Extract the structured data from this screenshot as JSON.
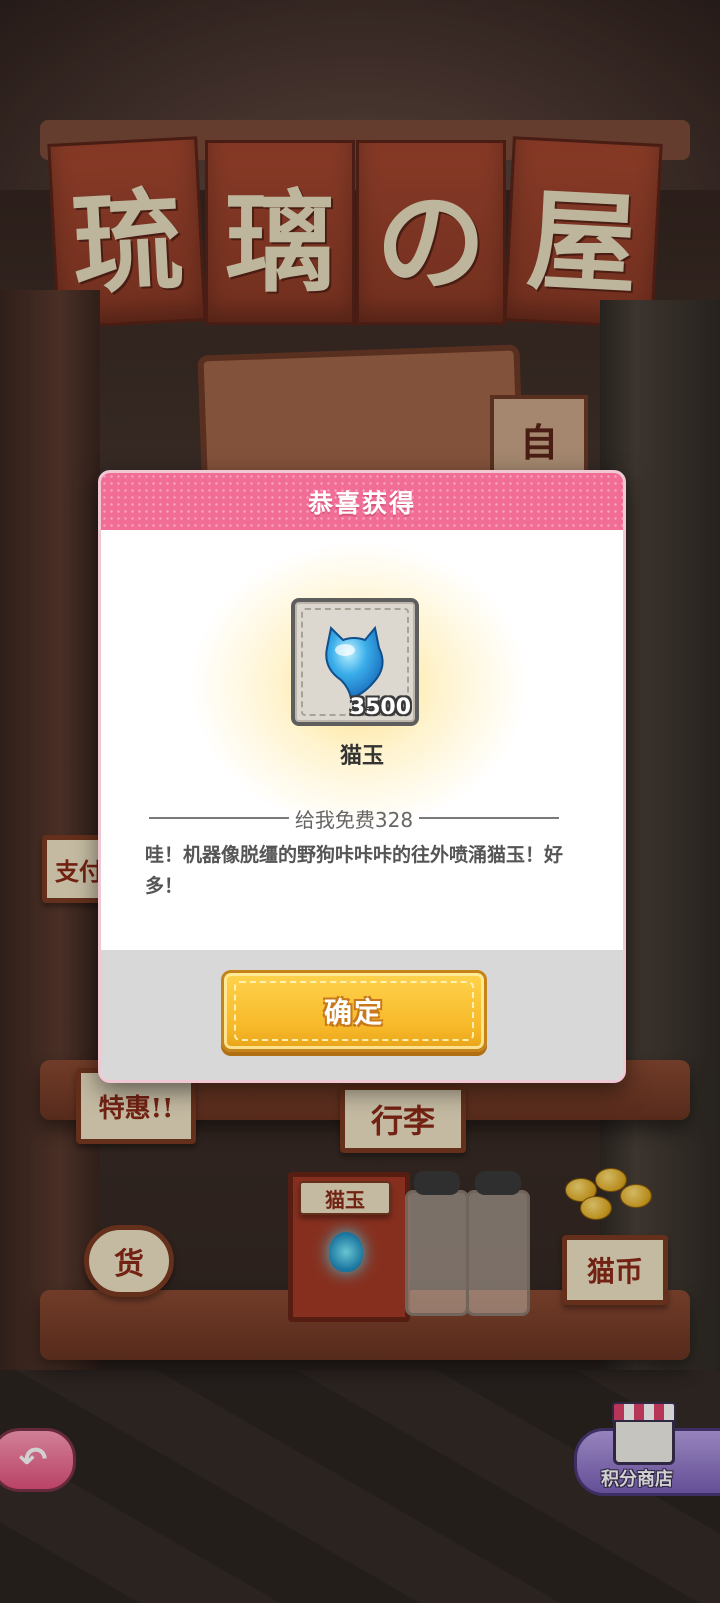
{
  "shop": {
    "banner_chars": [
      "琉",
      "璃",
      "の",
      "屋"
    ],
    "sign_char": "自",
    "paw_symbol": "🐾",
    "labels": {
      "special": "特惠!!",
      "luggage": "行李",
      "cat_jade_box": "猫玉",
      "cat_coin": "猫币",
      "left_box": "支付",
      "goods": "货"
    }
  },
  "dialog": {
    "title": "恭喜获得",
    "reward": {
      "name": "猫玉",
      "count": "3500",
      "icon": "cat-jade-icon",
      "icon_color": "#3aaeea"
    },
    "source": "给我免费328",
    "description": "哇！机器像脱缰的野狗咔咔咔的往外喷涌猫玉！好多！",
    "confirm_label": "确定"
  },
  "nav": {
    "back_icon": "back-arrow-icon",
    "points_shop_label": "积分商店"
  },
  "colors": {
    "header_pink": "#f26d96",
    "button_yellow": "#f7b92a",
    "back_pink": "#e2527e",
    "shop_purple": "#7b61b8"
  }
}
